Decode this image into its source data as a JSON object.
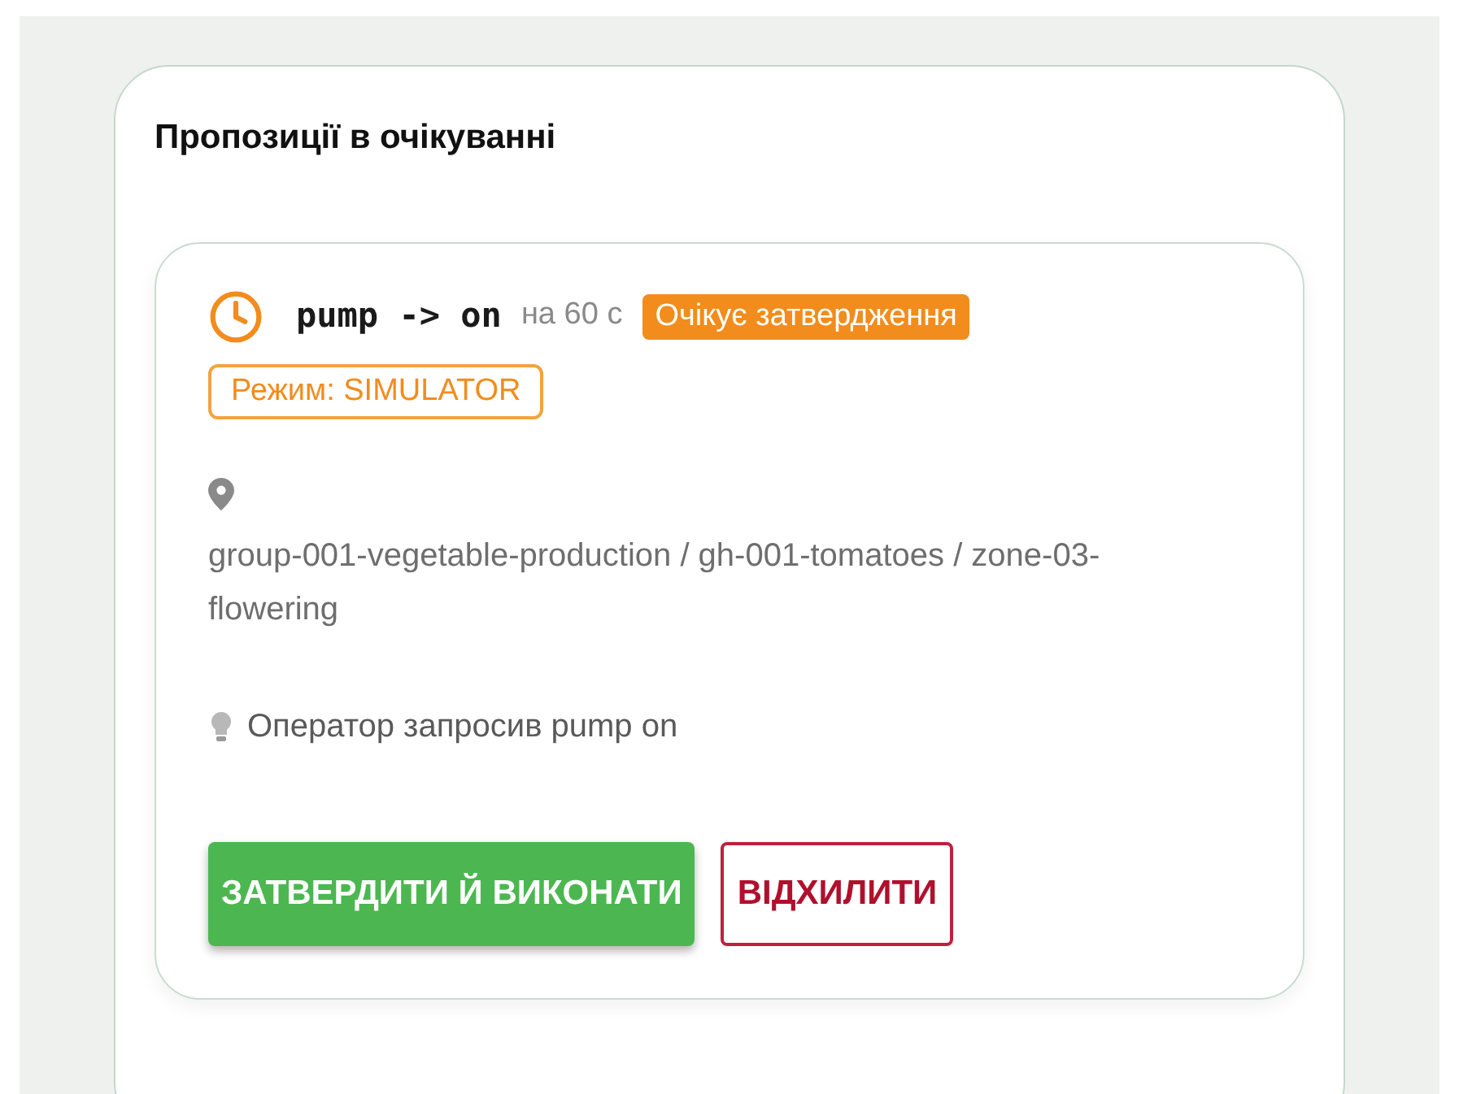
{
  "panel": {
    "title": "Пропозиції в очікуванні"
  },
  "proposals": [
    {
      "command": "pump -> on",
      "duration": "на 60 с",
      "status": {
        "kind": "pending",
        "label": "Очікує затвердження"
      },
      "mode": "Режим: SIMULATOR",
      "location": "group-001-vegetable-production / gh-001-tomatoes / zone-03-flowering",
      "reason": "Оператор запросив pump on",
      "approve": "ЗАТВЕРДИТИ Й ВИКОНАТИ",
      "reject": "ВІДХИЛИТИ"
    }
  ]
}
